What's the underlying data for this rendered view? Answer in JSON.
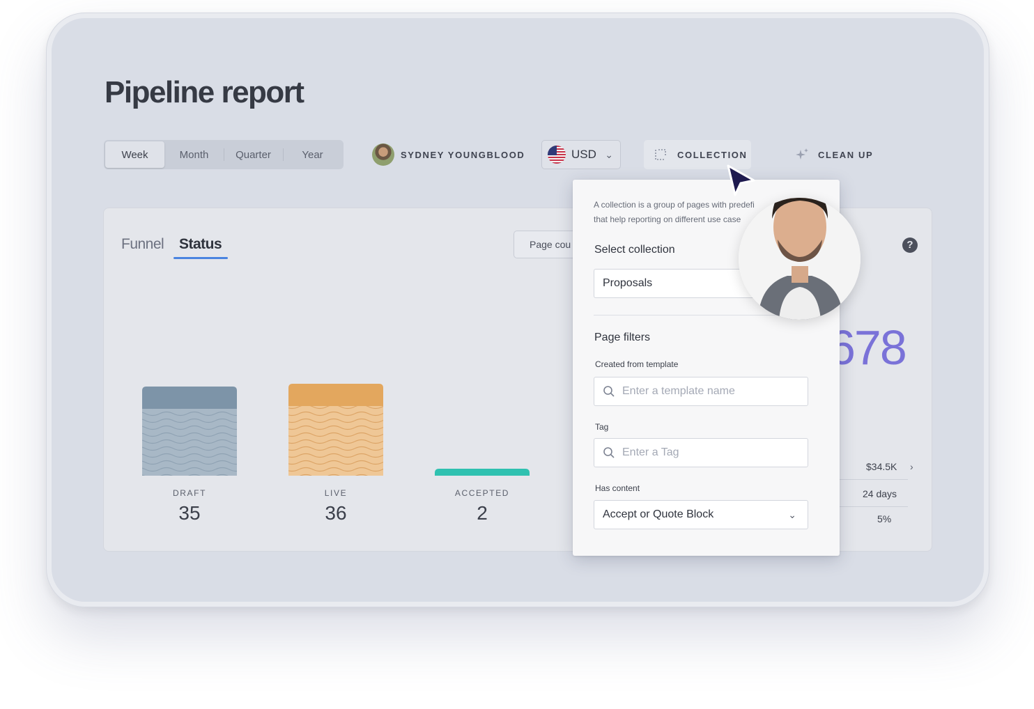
{
  "page": {
    "title": "Pipeline report"
  },
  "period": {
    "options": [
      "Week",
      "Month",
      "Quarter",
      "Year"
    ],
    "selected": "Week"
  },
  "user": {
    "name": "SYDNEY YOUNGBLOOD"
  },
  "currency": {
    "value": "USD"
  },
  "toolbar": {
    "collection_label": "COLLECTION",
    "cleanup_label": "CLEAN UP"
  },
  "card": {
    "tabs": [
      "Funnel",
      "Status"
    ],
    "active_tab": "Status",
    "page_count_label": "Page cou",
    "help_label": "?",
    "headline_number": "678",
    "stats": [
      "$34.5K",
      "24 days",
      "5%"
    ]
  },
  "chart_data": {
    "type": "bar",
    "categories": [
      "DRAFT",
      "LIVE",
      "ACCEPTED"
    ],
    "values": [
      35,
      36,
      2
    ],
    "colors": [
      "#7d94a8",
      "#e3a75e",
      "#2fc1b0"
    ],
    "xlabel": "",
    "ylabel": ""
  },
  "popover": {
    "description_line1": "A collection is a group of pages with predefi",
    "description_line2": "that help reporting on different use case",
    "select_heading": "Select collection",
    "selected_collection": "Proposals",
    "filters_heading": "Page filters",
    "template_label": "Created from template",
    "template_placeholder": "Enter a template name",
    "tag_label": "Tag",
    "tag_placeholder": "Enter a Tag",
    "content_label": "Has content",
    "content_value": "Accept or Quote Block"
  },
  "icons": {
    "search": "search-icon",
    "chevron": "chevron-down-icon",
    "sparkle": "sparkle-icon",
    "collection": "collection-icon"
  }
}
